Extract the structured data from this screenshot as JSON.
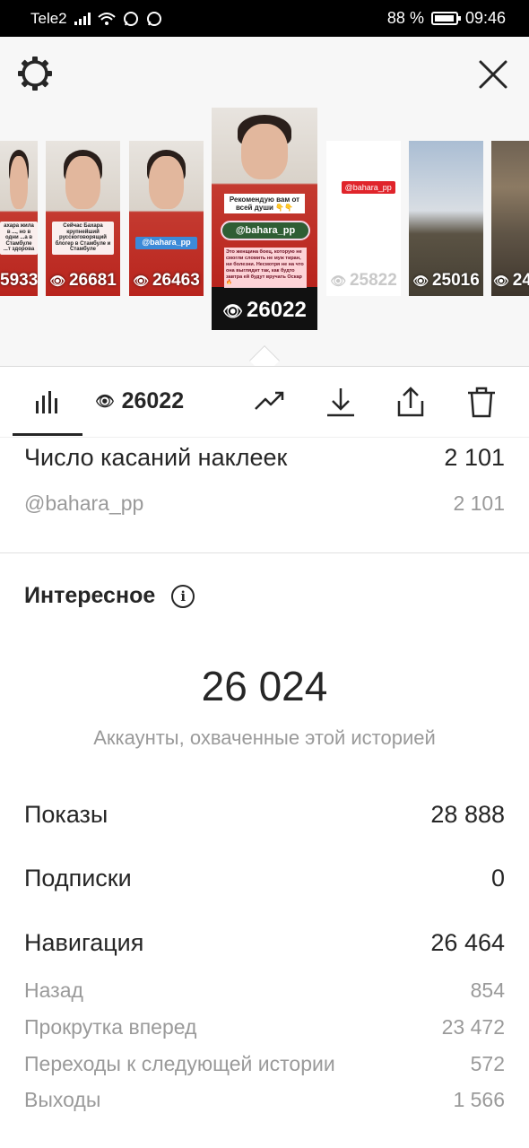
{
  "status_bar": {
    "carrier": "Tele2",
    "battery": "88 %",
    "time": "09:46"
  },
  "story_strip": {
    "thumbnails": [
      {
        "count": "5933",
        "caption": "ахара жила в ..., но в одни ...а в Стамбуле ...т здорова"
      },
      {
        "count": "26681",
        "caption": "Сейчас Бахара крупнейший русскоговорящий блогер в Стамбуле и Стамбуле"
      },
      {
        "count": "26463",
        "caption": "@bahara_pp"
      },
      {
        "count": "25822",
        "tag": "@bahara_pp"
      },
      {
        "count": "25016"
      },
      {
        "count": "24"
      }
    ],
    "active": {
      "count": "26022",
      "recommend_text": "Рекомендую вам от всей души 👇👇",
      "handle": "@bahara_pp",
      "description": "Это женщина боец, которую не смогли сломить не муж тиран, ни болезни. Несмотря не на что она выглядит так, как будто завтра ей будут вручать Оскар🔥"
    }
  },
  "toolbar": {
    "views": "26022"
  },
  "sticker_taps": {
    "label": "Число касаний наклеек",
    "value": "2 101",
    "sub_label": "@bahara_pp",
    "sub_value": "2 101"
  },
  "discovery": {
    "title": "Интересное",
    "reach": "26 024",
    "reach_label": "Аккаунты, охваченные этой историей",
    "impressions_label": "Показы",
    "impressions": "28 888",
    "follows_label": "Подписки",
    "follows": "0",
    "navigation_label": "Навигация",
    "navigation": "26 464",
    "nav_items": [
      {
        "label": "Назад",
        "value": "854"
      },
      {
        "label": "Прокрутка вперед",
        "value": "23 472"
      },
      {
        "label": "Переходы к следующей истории",
        "value": "572"
      },
      {
        "label": "Выходы",
        "value": "1 566"
      }
    ]
  }
}
